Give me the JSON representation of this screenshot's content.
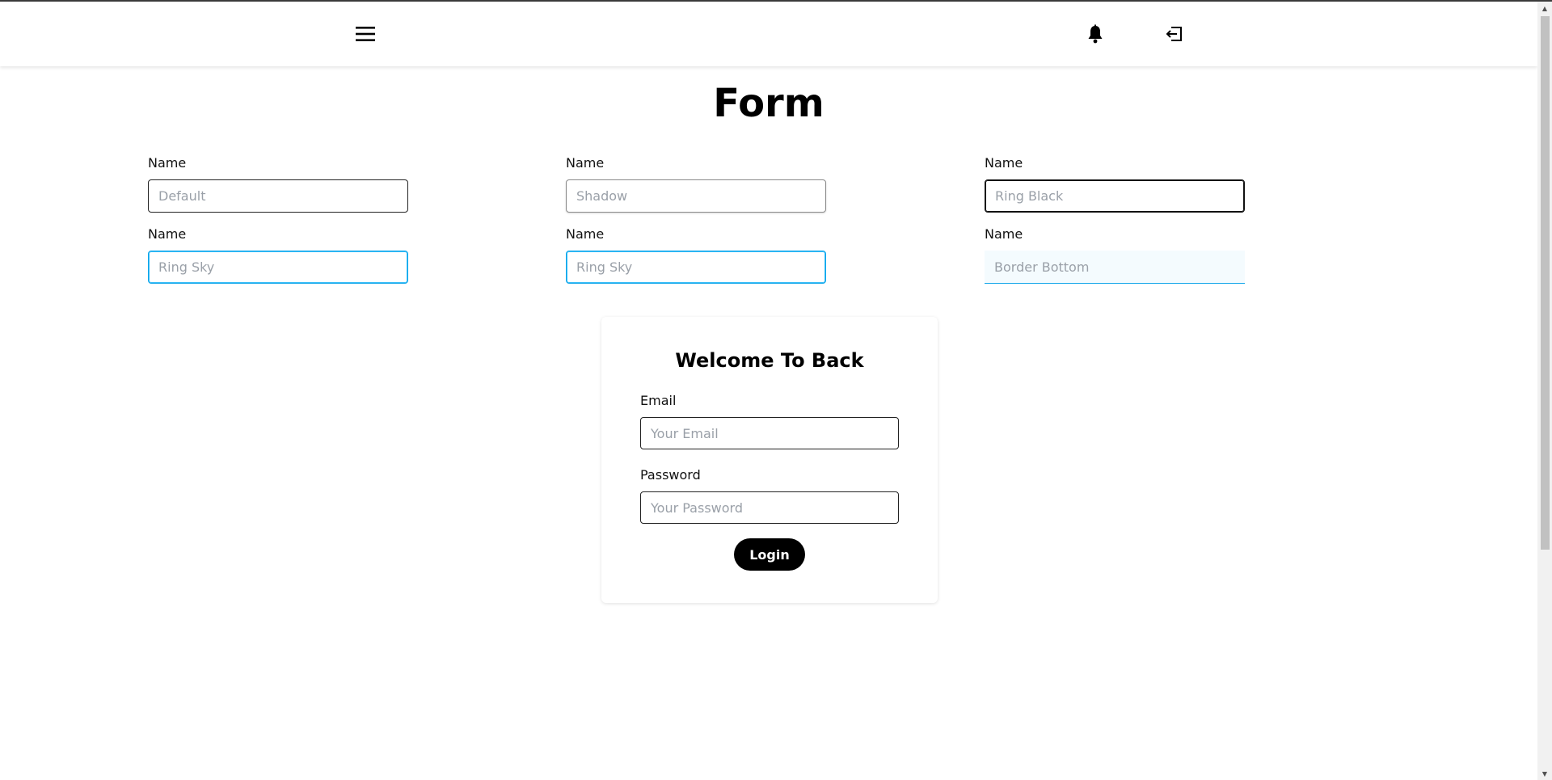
{
  "page": {
    "title": "Form"
  },
  "icons": {
    "menu": "hamburger-menu-icon",
    "notifications": "bell-icon",
    "logout": "logout-icon"
  },
  "fields": [
    {
      "label": "Name",
      "placeholder": "Default",
      "style": "default"
    },
    {
      "label": "Name",
      "placeholder": "Shadow",
      "style": "shadow"
    },
    {
      "label": "Name",
      "placeholder": "Ring Black",
      "style": "ring-black"
    },
    {
      "label": "Name",
      "placeholder": "Ring Sky",
      "style": "ring-sky"
    },
    {
      "label": "Name",
      "placeholder": "Ring Sky",
      "style": "ring-sky"
    },
    {
      "label": "Name",
      "placeholder": "Border Bottom",
      "style": "border-bottom"
    }
  ],
  "login": {
    "title": "Welcome To Back",
    "email_label": "Email",
    "email_placeholder": "Your Email",
    "password_label": "Password",
    "password_placeholder": "Your Password",
    "button_label": "Login"
  },
  "colors": {
    "sky": "#0ea5e9",
    "button_bg": "#000000"
  }
}
